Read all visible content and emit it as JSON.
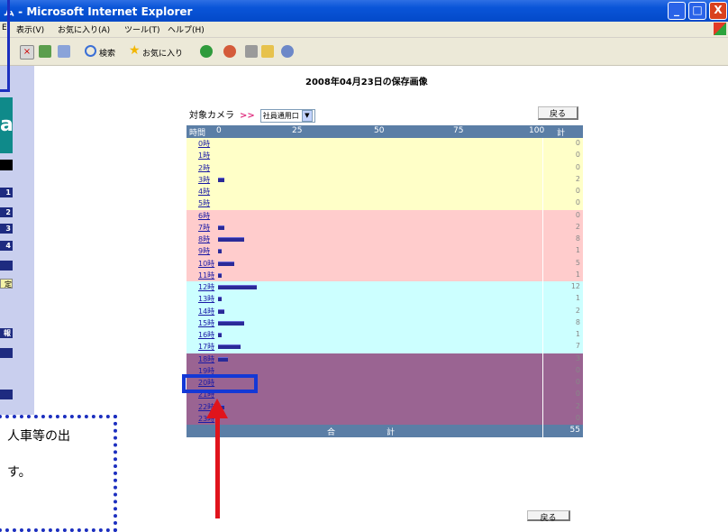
{
  "window": {
    "title": "ム - Microsoft Internet Explorer",
    "min_glyph": "_",
    "max_glyph": "□",
    "close_glyph": "X"
  },
  "menu": [
    "E)",
    "表示(V)",
    "お気に入り(A)",
    "ツール(T)",
    "ヘルプ(H)"
  ],
  "toolbar": {
    "search_label": "検索",
    "favorites_label": "お気に入り"
  },
  "sidebar": {
    "brand_letter": "a",
    "buttons": [
      "1",
      "2",
      "3",
      "4"
    ],
    "highlight_label": "定",
    "info_label": "報"
  },
  "page": {
    "heading": "2008年04月23日の保存画像",
    "camera_label": "対象カメラ",
    "arrow": ">>",
    "camera_selected": "社員通用口",
    "back_label": "戻る"
  },
  "table": {
    "header_time": "時間",
    "axis_ticks": [
      "0",
      "25",
      "50",
      "75",
      "100"
    ],
    "header_total": "計",
    "total_label_1": "合",
    "total_label_2": "計",
    "total_value": "55",
    "bands": {
      "night": "#ffffc8",
      "morning": "#ffcccc",
      "afternoon": "#ccffff",
      "evening": "#9a6492"
    },
    "rows": [
      {
        "hour": "0時",
        "count": "0",
        "value": 0,
        "band": "night"
      },
      {
        "hour": "1時",
        "count": "0",
        "value": 0,
        "band": "night"
      },
      {
        "hour": "2時",
        "count": "0",
        "value": 0,
        "band": "night"
      },
      {
        "hour": "3時",
        "count": "2",
        "value": 2,
        "band": "night"
      },
      {
        "hour": "4時",
        "count": "0",
        "value": 0,
        "band": "night"
      },
      {
        "hour": "5時",
        "count": "0",
        "value": 0,
        "band": "night"
      },
      {
        "hour": "6時",
        "count": "0",
        "value": 0,
        "band": "morning"
      },
      {
        "hour": "7時",
        "count": "2",
        "value": 2,
        "band": "morning"
      },
      {
        "hour": "8時",
        "count": "8",
        "value": 8,
        "band": "morning"
      },
      {
        "hour": "9時",
        "count": "1",
        "value": 1,
        "band": "morning"
      },
      {
        "hour": "10時",
        "count": "5",
        "value": 5,
        "band": "morning"
      },
      {
        "hour": "11時",
        "count": "1",
        "value": 1,
        "band": "morning"
      },
      {
        "hour": "12時",
        "count": "12",
        "value": 12,
        "band": "afternoon"
      },
      {
        "hour": "13時",
        "count": "1",
        "value": 1,
        "band": "afternoon"
      },
      {
        "hour": "14時",
        "count": "2",
        "value": 2,
        "band": "afternoon"
      },
      {
        "hour": "15時",
        "count": "8",
        "value": 8,
        "band": "afternoon"
      },
      {
        "hour": "16時",
        "count": "1",
        "value": 1,
        "band": "afternoon"
      },
      {
        "hour": "17時",
        "count": "7",
        "value": 7,
        "band": "afternoon"
      },
      {
        "hour": "18時",
        "count": "3",
        "value": 3,
        "band": "evening"
      },
      {
        "hour": "19時",
        "count": "0",
        "value": 0,
        "band": "evening"
      },
      {
        "hour": "20時",
        "count": "0",
        "value": 0,
        "band": "evening"
      },
      {
        "hour": "21時",
        "count": "0",
        "value": 0,
        "band": "evening"
      },
      {
        "hour": "22時",
        "count": "2",
        "value": 2,
        "band": "evening"
      },
      {
        "hour": "23時",
        "count": "0",
        "value": 0,
        "band": "evening"
      }
    ]
  },
  "annotation": {
    "line1": "人車等の出",
    "line2": "す。"
  }
}
